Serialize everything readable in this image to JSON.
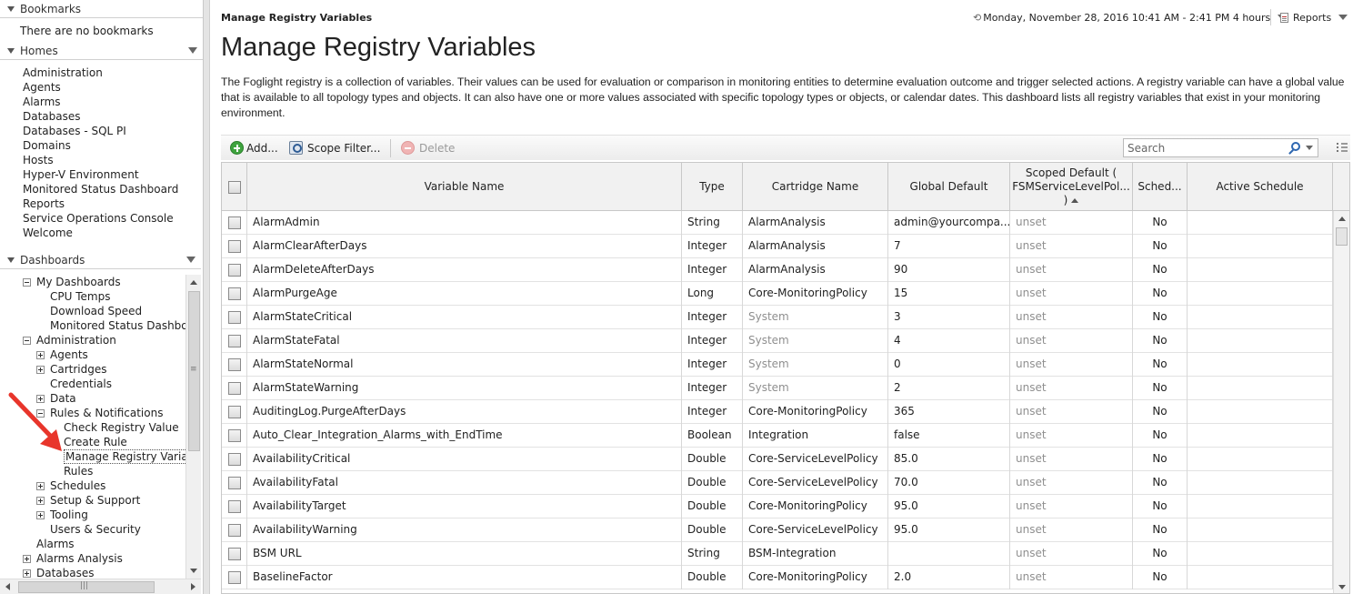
{
  "nav": {
    "bookmarks_title": "Bookmarks",
    "bookmarks_empty": "There are no bookmarks",
    "homes_title": "Homes",
    "homes": [
      "Administration",
      "Agents",
      "Alarms",
      "Databases",
      "Databases - SQL PI",
      "Domains",
      "Hosts",
      "Hyper-V Environment",
      "Monitored Status Dashboard",
      "Reports",
      "Service Operations Console",
      "Welcome"
    ],
    "dashboards_title": "Dashboards",
    "tree": [
      {
        "label": "My Dashboards",
        "toggle": "minus"
      },
      {
        "label": "CPU Temps",
        "toggle": ""
      },
      {
        "label": "Download Speed",
        "toggle": ""
      },
      {
        "label": "Monitored Status Dashboa",
        "toggle": ""
      },
      {
        "label": "Administration",
        "toggle": "minus"
      },
      {
        "label": "Agents",
        "toggle": "plus"
      },
      {
        "label": "Cartridges",
        "toggle": "plus"
      },
      {
        "label": "Credentials",
        "toggle": ""
      },
      {
        "label": "Data",
        "toggle": "plus"
      },
      {
        "label": "Rules & Notifications",
        "toggle": "minus"
      },
      {
        "label": "Check Registry Value",
        "toggle": ""
      },
      {
        "label": "Create Rule",
        "toggle": ""
      },
      {
        "label": "Manage Registry Variabl",
        "toggle": "",
        "selected": true
      },
      {
        "label": "Rules",
        "toggle": ""
      },
      {
        "label": "Schedules",
        "toggle": "plus"
      },
      {
        "label": "Setup & Support",
        "toggle": "plus"
      },
      {
        "label": "Tooling",
        "toggle": "plus"
      },
      {
        "label": "Users & Security",
        "toggle": ""
      },
      {
        "label": "Alarms",
        "toggle": ""
      },
      {
        "label": "Alarms Analysis",
        "toggle": "plus"
      },
      {
        "label": "Databases",
        "toggle": "plus"
      }
    ]
  },
  "header": {
    "breadcrumb": "Manage Registry Variables",
    "time_range": "Monday, November 28, 2016 10:41 AM - 2:41 PM 4 hours",
    "reports_label": "Reports"
  },
  "page": {
    "title": "Manage Registry Variables",
    "description": "The Foglight registry is a collection of variables. Their values can be used for evaluation or comparison in monitoring entities to determine evaluation outcome and trigger selected actions. A registry variable can have a global value that is available to all topology types and objects. It can also have one or more values associated with specific topology types or objects, or calendar dates. This dashboard lists all registry variables that exist in your monitoring environment."
  },
  "toolbar": {
    "add_label": "Add...",
    "scope_filter_label": "Scope Filter...",
    "delete_label": "Delete",
    "search_placeholder": "Search"
  },
  "table": {
    "columns": {
      "variable_name": "Variable Name",
      "type": "Type",
      "cartridge_name": "Cartridge Name",
      "global_default": "Global Default",
      "scoped_default_line1": "Scoped Default (",
      "scoped_default_line2": "FSMServiceLevelPol...",
      "scoped_default_line3": ")",
      "scheduled": "Sched...",
      "active_schedule": "Active Schedule"
    },
    "rows": [
      {
        "name": "AlarmAdmin",
        "type": "String",
        "cartridge": "AlarmAnalysis",
        "cartridge_muted": false,
        "global": "admin@yourcompa...",
        "scoped": "unset",
        "sched": "No",
        "active": ""
      },
      {
        "name": "AlarmClearAfterDays",
        "type": "Integer",
        "cartridge": "AlarmAnalysis",
        "cartridge_muted": false,
        "global": "7",
        "scoped": "unset",
        "sched": "No",
        "active": ""
      },
      {
        "name": "AlarmDeleteAfterDays",
        "type": "Integer",
        "cartridge": "AlarmAnalysis",
        "cartridge_muted": false,
        "global": "90",
        "scoped": "unset",
        "sched": "No",
        "active": ""
      },
      {
        "name": "AlarmPurgeAge",
        "type": "Long",
        "cartridge": "Core-MonitoringPolicy",
        "cartridge_muted": false,
        "global": "15",
        "scoped": "unset",
        "sched": "No",
        "active": ""
      },
      {
        "name": "AlarmStateCritical",
        "type": "Integer",
        "cartridge": "System",
        "cartridge_muted": true,
        "global": "3",
        "scoped": "unset",
        "sched": "No",
        "active": ""
      },
      {
        "name": "AlarmStateFatal",
        "type": "Integer",
        "cartridge": "System",
        "cartridge_muted": true,
        "global": "4",
        "scoped": "unset",
        "sched": "No",
        "active": ""
      },
      {
        "name": "AlarmStateNormal",
        "type": "Integer",
        "cartridge": "System",
        "cartridge_muted": true,
        "global": "0",
        "scoped": "unset",
        "sched": "No",
        "active": ""
      },
      {
        "name": "AlarmStateWarning",
        "type": "Integer",
        "cartridge": "System",
        "cartridge_muted": true,
        "global": "2",
        "scoped": "unset",
        "sched": "No",
        "active": ""
      },
      {
        "name": "AuditingLog.PurgeAfterDays",
        "type": "Integer",
        "cartridge": "Core-MonitoringPolicy",
        "cartridge_muted": false,
        "global": "365",
        "scoped": "unset",
        "sched": "No",
        "active": ""
      },
      {
        "name": "Auto_Clear_Integration_Alarms_with_EndTime",
        "type": "Boolean",
        "cartridge": "Integration",
        "cartridge_muted": false,
        "global": "false",
        "scoped": "unset",
        "sched": "No",
        "active": ""
      },
      {
        "name": "AvailabilityCritical",
        "type": "Double",
        "cartridge": "Core-ServiceLevelPolicy",
        "cartridge_muted": false,
        "global": "85.0",
        "scoped": "unset",
        "sched": "No",
        "active": ""
      },
      {
        "name": "AvailabilityFatal",
        "type": "Double",
        "cartridge": "Core-ServiceLevelPolicy",
        "cartridge_muted": false,
        "global": "70.0",
        "scoped": "unset",
        "sched": "No",
        "active": ""
      },
      {
        "name": "AvailabilityTarget",
        "type": "Double",
        "cartridge": "Core-MonitoringPolicy",
        "cartridge_muted": false,
        "global": "95.0",
        "scoped": "unset",
        "sched": "No",
        "active": ""
      },
      {
        "name": "AvailabilityWarning",
        "type": "Double",
        "cartridge": "Core-ServiceLevelPolicy",
        "cartridge_muted": false,
        "global": "95.0",
        "scoped": "unset",
        "sched": "No",
        "active": ""
      },
      {
        "name": "BSM URL",
        "type": "String",
        "cartridge": "BSM-Integration",
        "cartridge_muted": false,
        "global": "",
        "scoped": "unset",
        "sched": "No",
        "active": ""
      },
      {
        "name": "BaselineFactor",
        "type": "Double",
        "cartridge": "Core-MonitoringPolicy",
        "cartridge_muted": false,
        "global": "2.0",
        "scoped": "unset",
        "sched": "No",
        "active": ""
      }
    ]
  },
  "colors": {
    "muted_text": "#8f8f8f",
    "add_icon": "#3ea33e",
    "annotation_arrow": "#e8352b"
  }
}
